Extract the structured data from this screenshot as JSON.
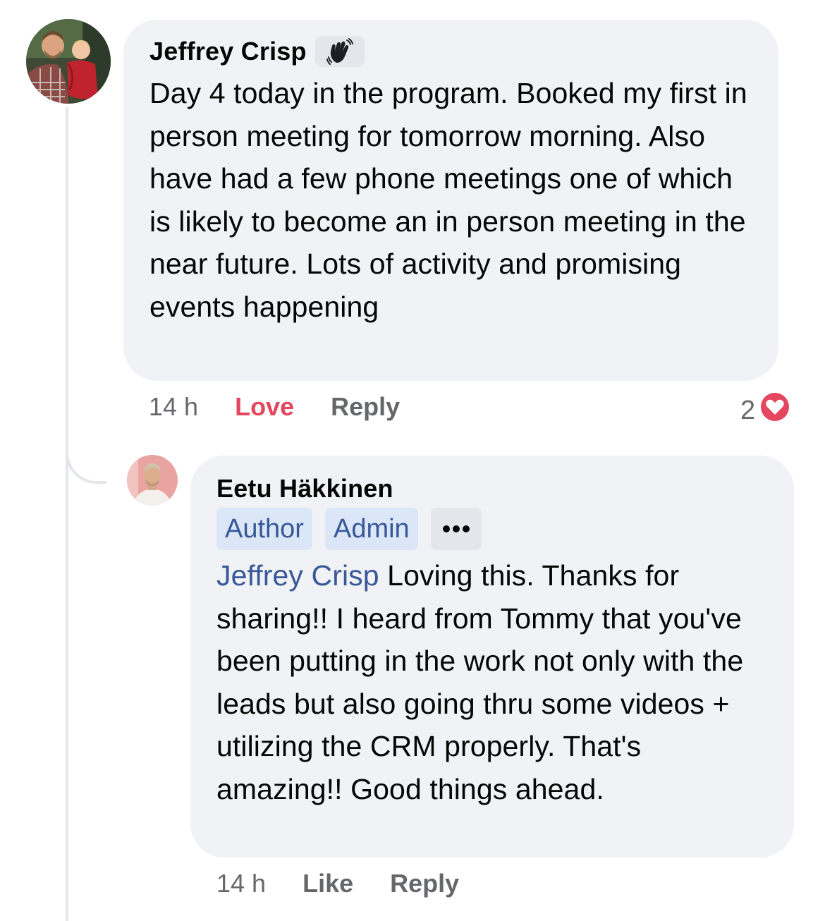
{
  "comments": [
    {
      "author": "Jeffrey Crisp",
      "author_badge_icon": "waving-hand-icon",
      "text": "Day 4 today in the program. Booked my first in person meeting for tomorrow morning. Also have had a few phone meetings one of which is likely to become an in person meeting in the near future. Lots of activity and promising events happening",
      "time": "14 h",
      "actions": {
        "love": "Love",
        "reply": "Reply"
      },
      "reaction": {
        "count": "2",
        "icon": "heart-reaction-icon",
        "color": "#e4465d"
      }
    }
  ],
  "reply": {
    "author": "Eetu Häkkinen",
    "badges": [
      "Author",
      "Admin"
    ],
    "more_label": "•••",
    "mention": "Jeffrey Crisp",
    "text": "Loving this. Thanks for sharing!! I heard from Tommy that you've been putting in the work not only with the leads but also going thru some videos + utilizing the CRM properly. That's amazing!! Good things ahead.",
    "time": "14 h",
    "actions": {
      "like": "Like",
      "reply": "Reply"
    }
  },
  "colors": {
    "bubble": "#f0f2f5",
    "mention": "#385898",
    "badge_bg": "#dbe7f7",
    "secondary_text": "#65676b",
    "love": "#e4465d"
  }
}
